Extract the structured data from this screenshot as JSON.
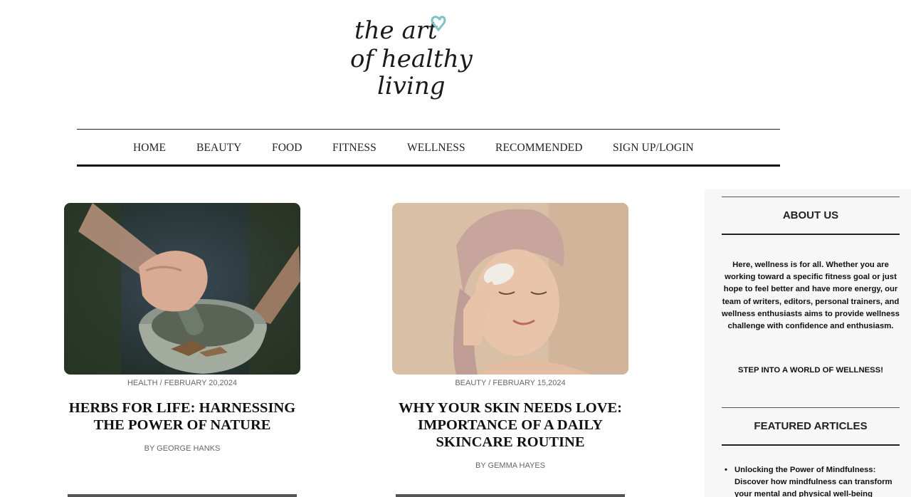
{
  "brand": {
    "logo_line1": "the art",
    "logo_line2": "of healthy",
    "logo_line3": "living",
    "accent_color": "#7cc4c4"
  },
  "nav": {
    "items": [
      {
        "label": "HOME"
      },
      {
        "label": "BEAUTY"
      },
      {
        "label": "FOOD"
      },
      {
        "label": "FITNESS"
      },
      {
        "label": "WELLNESS"
      },
      {
        "label": "RECOMMENDED"
      },
      {
        "label": "SIGN UP/LOGIN"
      }
    ]
  },
  "articles": [
    {
      "meta": "HEALTH / FEBRUARY 20,2024",
      "title": "HERBS FOR LIFE: HARNESSING THE POWER OF NATURE",
      "byline": "BY GEORGE HANKS",
      "image": "mortar-and-pestle-photo"
    },
    {
      "meta": "BEAUTY / FEBRUARY 15,2024",
      "title": "WHY YOUR SKIN NEEDS LOVE: IMPORTANCE OF A DAILY SKINCARE ROUTINE",
      "byline": "BY GEMMA HAYES",
      "image": "gua-sha-skincare-photo"
    }
  ],
  "sidebar": {
    "about_heading": "ABOUT US",
    "about_text": "Here, wellness is for all. Whether you are working toward a specific fitness goal or just hope to feel better and have more energy, our team of writers, editors, personal trainers, and wellness enthusiasts aims to provide wellness challenge with confidence and enthusiasm.",
    "cta": "STEP INTO A WORLD OF WELLNESS!",
    "featured_heading": "FEATURED ARTICLES",
    "featured_items": [
      "Unlocking the Power of Mindfulness: Discover how mindfulness can transform your mental and physical well-being"
    ]
  }
}
